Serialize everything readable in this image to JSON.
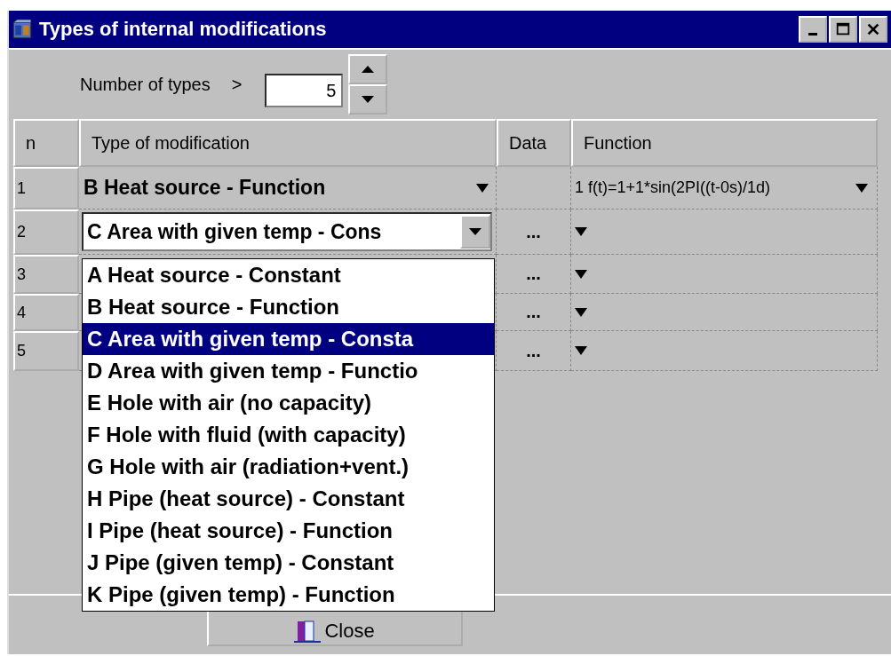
{
  "window": {
    "title": "Types of internal modifications"
  },
  "counter": {
    "label": "Number of types",
    "marker": ">",
    "value": "5"
  },
  "table": {
    "columns": [
      "n",
      "Type of modification",
      "Data",
      "Function"
    ],
    "rows": [
      {
        "n": "1",
        "editing": false,
        "type": "B Heat source - Function",
        "data": "",
        "function": "1 f(t)=1+1*sin(2PI((t-0s)/1d)"
      },
      {
        "n": "2",
        "editing": true,
        "type": "C Area with given temp - Cons",
        "data": "...",
        "function": ""
      },
      {
        "n": "3",
        "editing": false,
        "type": "",
        "data": "...",
        "function": ""
      },
      {
        "n": "4",
        "editing": false,
        "type": "",
        "data": "...",
        "function": ""
      },
      {
        "n": "5",
        "editing": false,
        "type": "",
        "data": "...",
        "function": ""
      }
    ]
  },
  "dropdown": {
    "open": true,
    "options": [
      {
        "label": "A Heat source - Constant",
        "selected": false
      },
      {
        "label": "B Heat source - Function",
        "selected": false
      },
      {
        "label": "C Area with given temp - Consta",
        "selected": true
      },
      {
        "label": "D Area with given temp - Functio",
        "selected": false
      },
      {
        "label": "E Hole with air (no capacity)",
        "selected": false
      },
      {
        "label": "F Hole with fluid (with capacity)",
        "selected": false
      },
      {
        "label": "G Hole with air (radiation+vent.)",
        "selected": false
      },
      {
        "label": "H Pipe (heat source) - Constant",
        "selected": false
      },
      {
        "label": "I Pipe (heat source) - Function",
        "selected": false
      },
      {
        "label": "J Pipe (given temp) - Constant",
        "selected": false
      },
      {
        "label": "K Pipe (given temp) - Function",
        "selected": false
      }
    ]
  },
  "buttons": [
    {
      "label": "Close"
    }
  ]
}
